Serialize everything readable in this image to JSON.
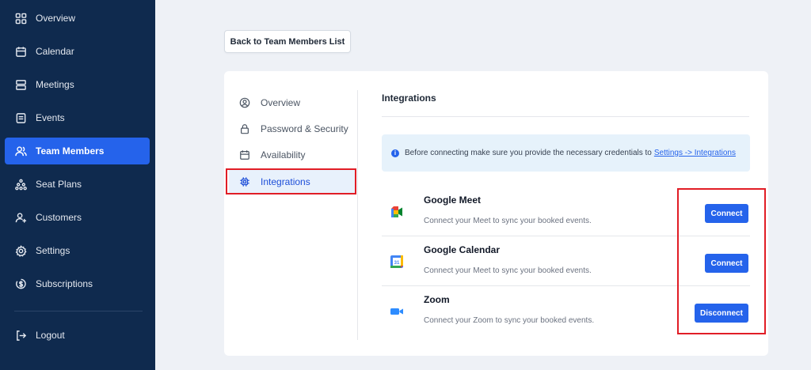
{
  "sidebar": {
    "items": [
      {
        "label": "Overview",
        "icon": "grid-icon"
      },
      {
        "label": "Calendar",
        "icon": "calendar-icon"
      },
      {
        "label": "Meetings",
        "icon": "layers-icon"
      },
      {
        "label": "Events",
        "icon": "list-icon"
      },
      {
        "label": "Team Members",
        "icon": "users-icon",
        "active": true
      },
      {
        "label": "Seat Plans",
        "icon": "seats-icon"
      },
      {
        "label": "Customers",
        "icon": "user-plus-icon"
      },
      {
        "label": "Settings",
        "icon": "gear-icon"
      },
      {
        "label": "Subscriptions",
        "icon": "dollar-icon"
      }
    ],
    "logout": {
      "label": "Logout",
      "icon": "logout-icon"
    }
  },
  "back_button": {
    "label": "Back to Team Members List"
  },
  "tabs": [
    {
      "label": "Overview",
      "icon": "user-circle-icon"
    },
    {
      "label": "Password & Security",
      "icon": "lock-icon"
    },
    {
      "label": "Availability",
      "icon": "calendar-icon"
    },
    {
      "label": "Integrations",
      "icon": "chip-icon",
      "active": true
    }
  ],
  "panel": {
    "title": "Integrations",
    "info": {
      "text": "Before connecting make sure you provide the necessary credentials to",
      "link": "Settings -> Integrations"
    },
    "integrations": [
      {
        "name": "Google Meet",
        "description": "Connect your Meet to sync your booked events.",
        "button": "Connect",
        "icon": "google-meet-icon"
      },
      {
        "name": "Google Calendar",
        "description": "Connect your Meet to sync your booked events.",
        "button": "Connect",
        "icon": "google-calendar-icon"
      },
      {
        "name": "Zoom",
        "description": "Connect your Zoom to sync your booked events.",
        "button": "Disconnect",
        "icon": "zoom-icon"
      }
    ]
  },
  "colors": {
    "sidebar_bg": "#0f2a4e",
    "accent": "#2563eb",
    "highlight_box": "#e11d26"
  }
}
